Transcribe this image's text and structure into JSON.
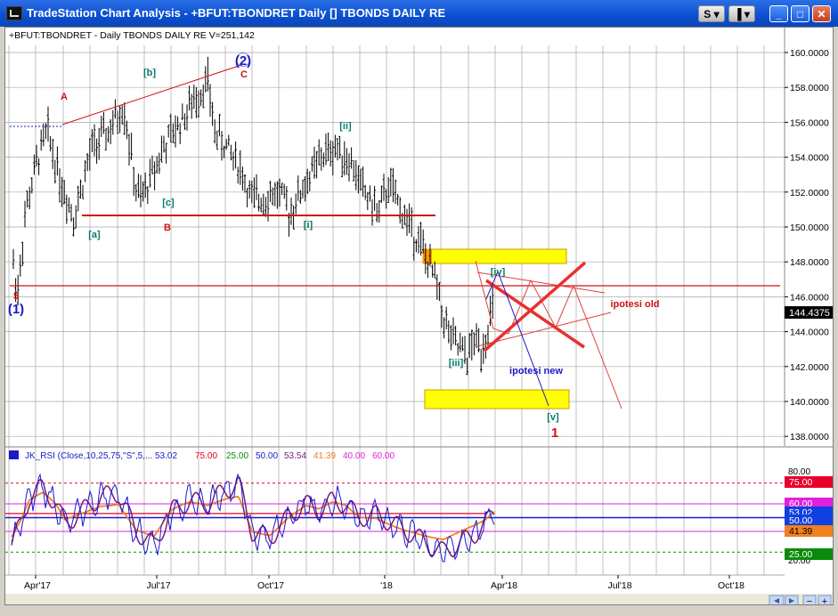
{
  "window": {
    "title": "TradeStation Chart Analysis - +BFUT:TBONDRET Daily [] TBONDS DAILY RE",
    "btn_s": "S",
    "btn_indicator": "▾",
    "btn_minimize": "_",
    "btn_maximize": "□",
    "btn_close": "✕"
  },
  "chart_header": "+BFUT:TBONDRET - Daily  TBONDS DAILY RE  V=251,142",
  "price_axis": [
    "160.0000",
    "158.0000",
    "156.0000",
    "154.0000",
    "152.0000",
    "150.0000",
    "148.0000",
    "146.0000",
    "144.0000",
    "142.0000",
    "140.0000",
    "138.0000"
  ],
  "last_price": "144.4375",
  "time_axis": [
    "Apr'17",
    "Jul'17",
    "Oct'17",
    "'18",
    "Apr'18",
    "Jul'18",
    "Oct'18"
  ],
  "annotations": {
    "w2": "(2)",
    "wC": "C",
    "wA": "A",
    "wb": "[b]",
    "w5": "5",
    "w1p": "(1)",
    "wa": "[a]",
    "wB": "B",
    "wc": "[c]",
    "wi": "[i]",
    "wii": "[ii]",
    "wiv": "[iv]",
    "wiii": "[iii]",
    "ipotesi_new": "ipotesi new",
    "ipotesi_old": "ipotesi old",
    "wv": "[v]",
    "w1": "1"
  },
  "rsi_header": {
    "name": "JK_RSI (Close,10,25,75,\"S\",5,...",
    "v1": "53.02",
    "v2": "75.00",
    "v3": "25.00",
    "v4": "50.00",
    "v5": "53.54",
    "v6": "41.39",
    "v7": "40.00",
    "v8": "60.00"
  },
  "rsi_axis": [
    "80.00",
    "20.00"
  ],
  "rsi_badges": [
    {
      "text": "75.00",
      "color": "#e8002a"
    },
    {
      "text": "60.00",
      "color": "#e020e0"
    },
    {
      "text": "53.02",
      "color": "#1040e0"
    },
    {
      "text": "50.00",
      "color": "#1040e0"
    },
    {
      "text": "41.39",
      "color": "#f08020"
    },
    {
      "text": "25.00",
      "color": "#0a8a0a"
    }
  ],
  "colors": {
    "bars": "#000000",
    "wave_teal": "#0a7a6a",
    "wave_red": "#d01010",
    "wave_blue": "#1a1ac8",
    "highlight": "#ffff00",
    "rsi_blue": "#1a1ad0",
    "rsi_orange": "#f08020",
    "rsi_purple": "#7a1a7a"
  },
  "chart_data": {
    "type": "ohlc",
    "price_axis_range": [
      137,
      161
    ],
    "anchors": [
      [
        0,
        149.0
      ],
      [
        6,
        146.0
      ],
      [
        16,
        151.0
      ],
      [
        30,
        154.0
      ],
      [
        40,
        155.5
      ],
      [
        56,
        152.5
      ],
      [
        70,
        150.6
      ],
      [
        90,
        154.5
      ],
      [
        110,
        155.5
      ],
      [
        126,
        157.0
      ],
      [
        140,
        152.0
      ],
      [
        146,
        151.6
      ],
      [
        170,
        154.5
      ],
      [
        196,
        156.5
      ],
      [
        212,
        157.8
      ],
      [
        220,
        158.4
      ],
      [
        228,
        155.5
      ],
      [
        256,
        153.5
      ],
      [
        270,
        151.5
      ],
      [
        300,
        152.0
      ],
      [
        312,
        150.8
      ],
      [
        330,
        152.5
      ],
      [
        348,
        154.0
      ],
      [
        364,
        154.6
      ],
      [
        380,
        153.8
      ],
      [
        396,
        152.0
      ],
      [
        412,
        150.8
      ],
      [
        424,
        152.5
      ],
      [
        432,
        151.5
      ],
      [
        448,
        150.0
      ],
      [
        460,
        149.0
      ],
      [
        468,
        147.8
      ],
      [
        476,
        147.0
      ],
      [
        484,
        145.0
      ],
      [
        494,
        143.5
      ],
      [
        506,
        142.8
      ],
      [
        512,
        142.5
      ],
      [
        520,
        143.5
      ],
      [
        528,
        143.0
      ],
      [
        536,
        144.5
      ],
      [
        542,
        145.5
      ]
    ],
    "rsi_anchors": [
      [
        0,
        30
      ],
      [
        10,
        45
      ],
      [
        20,
        65
      ],
      [
        35,
        72
      ],
      [
        50,
        60
      ],
      [
        60,
        45
      ],
      [
        80,
        55
      ],
      [
        100,
        65
      ],
      [
        120,
        68
      ],
      [
        140,
        40
      ],
      [
        160,
        30
      ],
      [
        180,
        55
      ],
      [
        200,
        62
      ],
      [
        220,
        60
      ],
      [
        240,
        70
      ],
      [
        255,
        75
      ],
      [
        270,
        40
      ],
      [
        290,
        35
      ],
      [
        310,
        50
      ],
      [
        330,
        60
      ],
      [
        345,
        55
      ],
      [
        360,
        62
      ],
      [
        375,
        60
      ],
      [
        390,
        50
      ],
      [
        410,
        52
      ],
      [
        430,
        45
      ],
      [
        450,
        38
      ],
      [
        470,
        30
      ],
      [
        485,
        25
      ],
      [
        500,
        30
      ],
      [
        520,
        38
      ],
      [
        532,
        45
      ],
      [
        542,
        55
      ]
    ],
    "rsi_levels": {
      "ob": 75,
      "os": 25,
      "mid": 50,
      "hi": 60,
      "lo": 40
    }
  }
}
